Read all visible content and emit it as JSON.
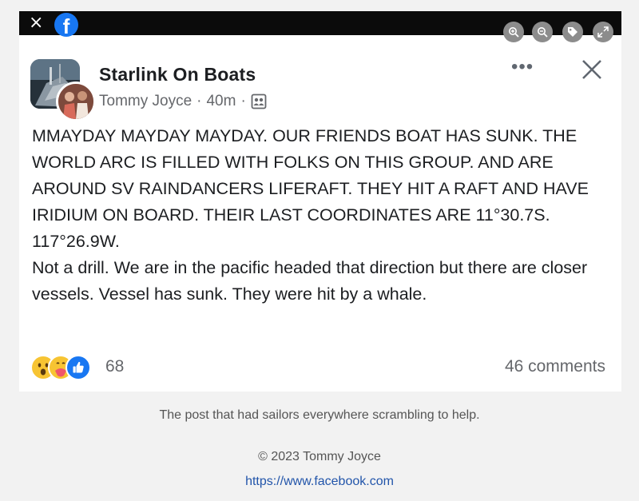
{
  "topbar": {
    "close_glyph": "×",
    "logo_glyph": "f",
    "tools": [
      {
        "icon": "zoom-in-icon"
      },
      {
        "icon": "zoom-out-icon"
      },
      {
        "icon": "tag-icon"
      },
      {
        "icon": "expand-icon"
      }
    ]
  },
  "post": {
    "group_name": "Starlink On Boats",
    "author": "Tommy Joyce",
    "time": "40m",
    "dot": "·",
    "privacy_icon": "group-members-icon",
    "more_glyph": "•••",
    "text_upper": "MMAYDAY MAYDAY MAYDAY. OUR FRIENDS BOAT HAS SUNK. THE WORLD ARC IS FILLED WITH FOLKS ON THIS GROUP. AND ARE AROUND SV RAINDANCERS LIFERAFT. THEY HIT A RAFT AND HAVE IRIDIUM ON BOARD. THEIR LAST COORDINATES ARE 11°30.7S. 117°26.9W.",
    "text_lower": "Not a drill. We are in the pacific headed that direction but there are closer vessels. Vessel has sunk. They were hit by a whale.",
    "reactions": [
      "wow",
      "care",
      "like"
    ],
    "reaction_count": "68",
    "comments": "46 comments"
  },
  "caption": "The post that had sailors everywhere scrambling to help.",
  "copyright": "© 2023 Tommy Joyce",
  "source_url": "https://www.facebook.com",
  "colors": {
    "facebook_blue": "#1877f2",
    "text_primary": "#1c1e21",
    "text_secondary": "#65676b",
    "link": "#2255aa"
  }
}
